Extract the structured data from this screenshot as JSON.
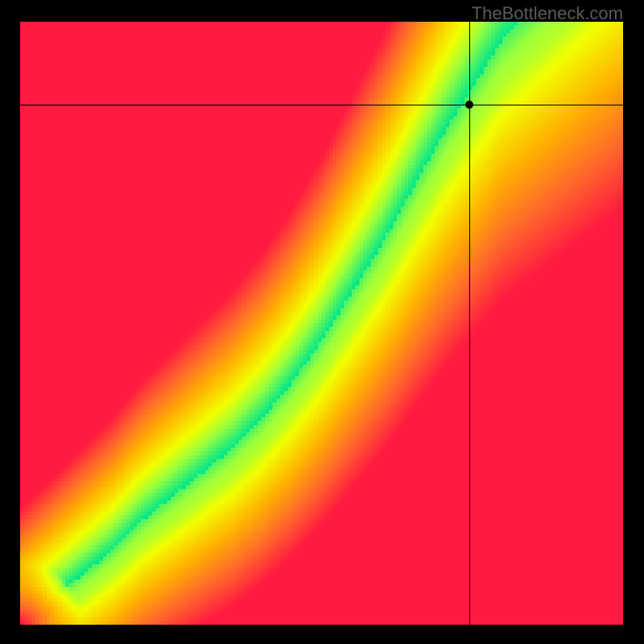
{
  "watermark": "TheBottleneck.com",
  "chart_data": {
    "type": "heatmap",
    "title": "",
    "xlabel": "",
    "ylabel": "",
    "xlim": [
      0,
      1
    ],
    "ylim": [
      0,
      1
    ],
    "note": "Axis units not shown on screen; coordinates below are normalized fractions of the plot area (0..1), with y = 0 at the top of the plot.",
    "marker": {
      "x": 0.745,
      "y": 0.137
    },
    "crosshair": {
      "x": 0.745,
      "y": 0.137
    },
    "optimal_band_center_points": [
      {
        "x": 0.0,
        "y": 1.0
      },
      {
        "x": 0.05,
        "y": 0.96
      },
      {
        "x": 0.1,
        "y": 0.92
      },
      {
        "x": 0.15,
        "y": 0.88
      },
      {
        "x": 0.2,
        "y": 0.83
      },
      {
        "x": 0.25,
        "y": 0.79
      },
      {
        "x": 0.3,
        "y": 0.75
      },
      {
        "x": 0.35,
        "y": 0.71
      },
      {
        "x": 0.4,
        "y": 0.66
      },
      {
        "x": 0.45,
        "y": 0.6
      },
      {
        "x": 0.5,
        "y": 0.53
      },
      {
        "x": 0.55,
        "y": 0.45
      },
      {
        "x": 0.6,
        "y": 0.37
      },
      {
        "x": 0.65,
        "y": 0.28
      },
      {
        "x": 0.7,
        "y": 0.19
      },
      {
        "x": 0.75,
        "y": 0.11
      },
      {
        "x": 0.8,
        "y": 0.03
      },
      {
        "x": 0.83,
        "y": 0.0
      }
    ],
    "color_scale": [
      {
        "value": 0.0,
        "color": "#ff1a40"
      },
      {
        "value": 0.25,
        "color": "#ff6a2a"
      },
      {
        "value": 0.5,
        "color": "#ffb300"
      },
      {
        "value": 0.75,
        "color": "#f2ff00"
      },
      {
        "value": 0.9,
        "color": "#9eff3a"
      },
      {
        "value": 1.0,
        "color": "#00e68c"
      }
    ],
    "grid": false,
    "legend": false
  },
  "colors": {
    "background": "#000000",
    "crosshair": "#000000",
    "marker": "#000000",
    "watermark": "#5a5a5a"
  }
}
